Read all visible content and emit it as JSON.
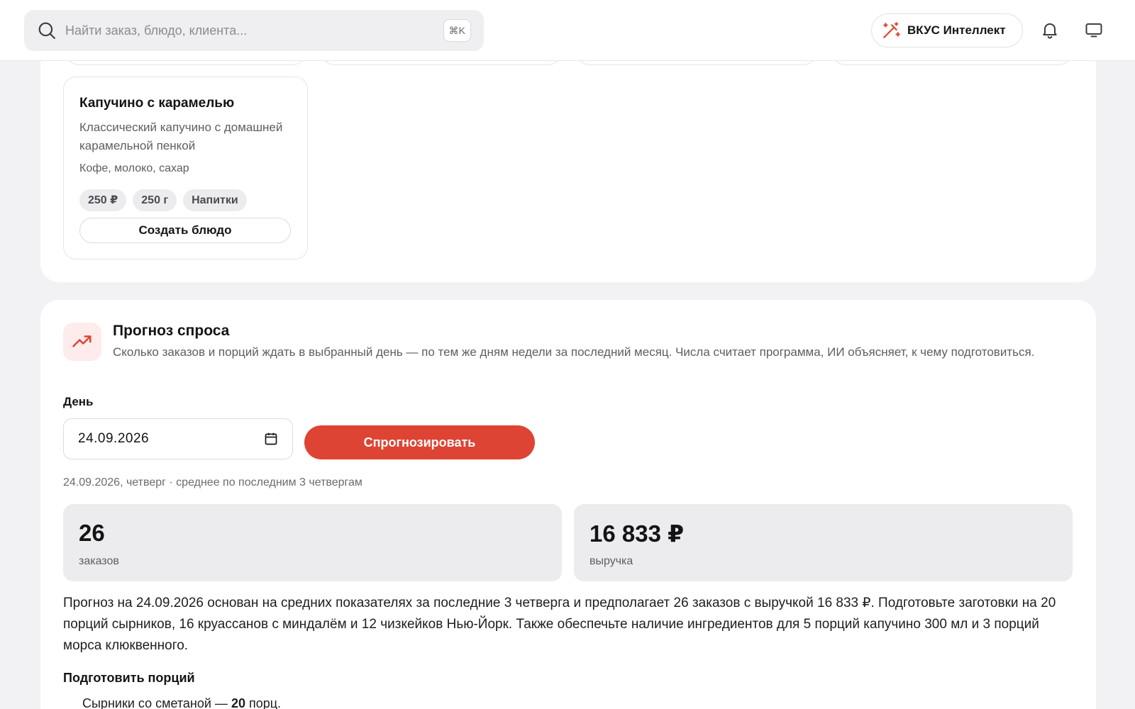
{
  "header": {
    "search_placeholder": "Найти заказ, блюдо, клиента...",
    "search_shortcut": "⌘K",
    "ai_button_label": "ВКУС Интеллект",
    "notifications_icon": "bell-icon",
    "display_icon": "monitor-icon"
  },
  "dish": {
    "title": "Капучино с карамелью",
    "description": "Классический капучино с домашней карамельной пенкой",
    "ingredients": "Кофе, молоко, сахар",
    "chips": [
      "250 ₽",
      "250 г",
      "Напитки"
    ],
    "create_label": "Создать блюдо"
  },
  "forecast": {
    "title": "Прогноз спроса",
    "subtitle": "Сколько заказов и порций ждать в выбранный день — по тем же дням недели за последний месяц. Числа считает программа, ИИ объясняет, к чему подготовиться.",
    "day_label": "День",
    "day_value": "24.09.2026",
    "button_label": "Спрогнозировать",
    "meta": "24.09.2026, четверг · среднее по последним 3 четвергам",
    "orders_value": "26",
    "orders_label": "заказов",
    "revenue_value": "16 833 ₽",
    "revenue_label": "выручка",
    "explanation": "Прогноз на 24.09.2026 основан на средних показателях за последние 3 четверга и предполагает 26 заказов с выручкой 16 833 ₽. Подготовьте заготовки на 20 порций сырников, 16 круассанов с миндалём и 12 чизкейков Нью-Йорк. Также обеспечьте наличие ингредиентов для 5 порций капучино 300 мл и 3 порций морса клюквенного.",
    "prep_title": "Подготовить порций",
    "prep_items": [
      {
        "name": "Сырники со сметаной — ",
        "qty": "20",
        "unit": " порц."
      }
    ]
  },
  "colors": {
    "accent": "#de4433",
    "background": "#f2f2f4",
    "stat_background": "#ececef"
  }
}
